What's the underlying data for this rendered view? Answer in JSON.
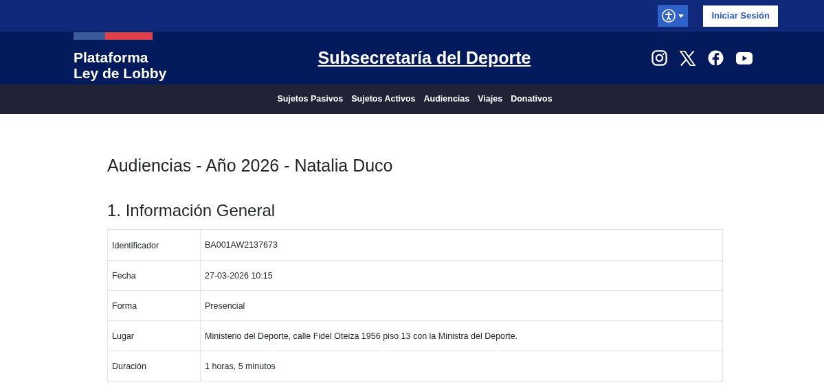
{
  "top_bar": {
    "login_button": "Iniciar Sesión"
  },
  "header": {
    "logo_lines": [
      "Plataforma",
      "Ley de Lobby"
    ],
    "institution": "Subsecretaría del Deporte"
  },
  "nav": [
    "Sujetos Pasivos",
    "Sujetos Activos",
    "Audiencias",
    "Viajes",
    "Donativos"
  ],
  "page_title": "Audiencias - Año 2026 - Natalia Duco",
  "section_title": "1. Información General",
  "table": {
    "rows": [
      {
        "label": "Identificador",
        "value": "BA001AW2137673"
      },
      {
        "label": "Fecha",
        "value": "27-03-2026 10:15"
      },
      {
        "label": "Forma",
        "value": "Presencial"
      },
      {
        "label": "Lugar",
        "value": "Ministerio del Deporte, calle Fidel Oteiza 1956 piso 13 con la Ministra del Deporte."
      },
      {
        "label": "Duración",
        "value": "1 horas, 5 minutos"
      }
    ]
  }
}
